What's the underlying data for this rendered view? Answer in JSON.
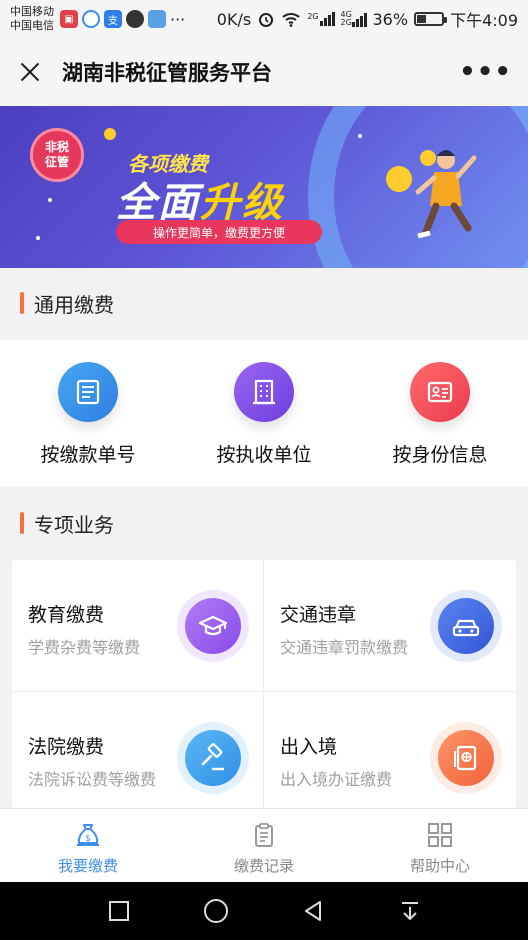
{
  "status_bar": {
    "carrier_1": "中国移动",
    "carrier_2": "中国电信",
    "speed": "0K/s",
    "network_1": "2G",
    "network_2": "4G 2G",
    "battery": "36%",
    "battery_level": 0.36,
    "time": "下午4:09",
    "more": "···"
  },
  "title_bar": {
    "title": "湖南非税征管服务平台",
    "more": "•••"
  },
  "banner": {
    "badge": "非税征管",
    "subtitle": "各项缴费",
    "headline_1": "全面",
    "headline_2": "升级",
    "tagline": "操作更简单，缴费更方便"
  },
  "general_section": {
    "title": "通用缴费",
    "items": [
      {
        "label": "按缴款单号",
        "icon": "document-icon",
        "color": "#3a8fe8"
      },
      {
        "label": "按执收单位",
        "icon": "building-icon",
        "color": "#7b4ae6"
      },
      {
        "label": "按身份信息",
        "icon": "id-card-icon",
        "color": "#f0455a"
      }
    ]
  },
  "special_section": {
    "title": "专项业务",
    "items": [
      {
        "title": "教育缴费",
        "desc": "学费杂费等缴费",
        "icon": "graduation-cap-icon",
        "color": "#9b5cf0"
      },
      {
        "title": "交通违章",
        "desc": "交通违章罚款缴费",
        "icon": "car-icon",
        "color": "#3f6be0"
      },
      {
        "title": "法院缴费",
        "desc": "法院诉讼费等缴费",
        "icon": "gavel-icon",
        "color": "#3aa3ee"
      },
      {
        "title": "出入境",
        "desc": "出入境办证缴费",
        "icon": "passport-icon",
        "color": "#f5774a"
      }
    ]
  },
  "tabbar": {
    "tabs": [
      {
        "label": "我要缴费",
        "icon": "money-bag-icon",
        "active": true
      },
      {
        "label": "缴费记录",
        "icon": "clipboard-icon",
        "active": false
      },
      {
        "label": "帮助中心",
        "icon": "grid-icon",
        "active": false
      }
    ]
  }
}
